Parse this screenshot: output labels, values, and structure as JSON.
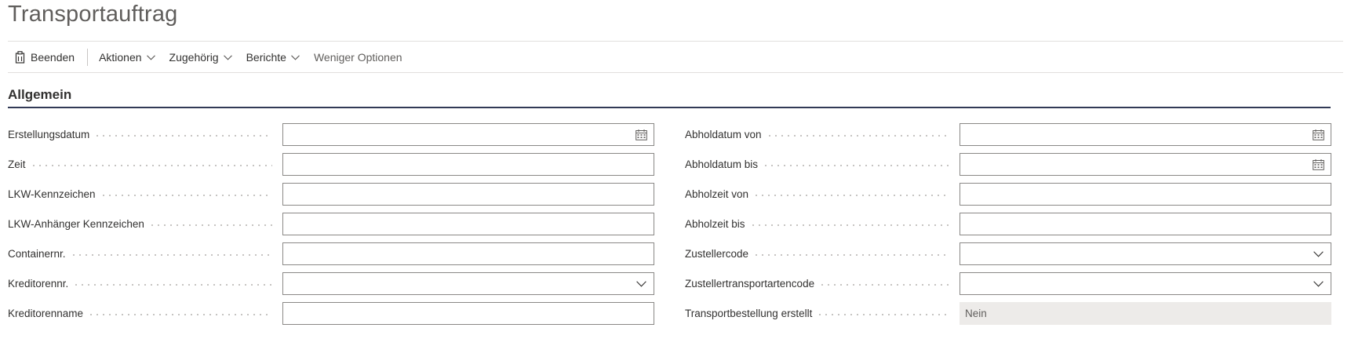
{
  "page": {
    "title": "Transportauftrag"
  },
  "actionbar": {
    "items": [
      {
        "label": "Beenden",
        "icon": "close-document-icon",
        "dropdown": false
      },
      {
        "label": "Aktionen",
        "dropdown": true
      },
      {
        "label": "Zugehörig",
        "dropdown": true
      },
      {
        "label": "Berichte",
        "dropdown": true
      },
      {
        "label": "Weniger Optionen",
        "dropdown": false
      }
    ]
  },
  "section": {
    "title": "Allgemein"
  },
  "fields": {
    "left": [
      {
        "label": "Erstellungsdatum",
        "value": "",
        "control": "date"
      },
      {
        "label": "Zeit",
        "value": "",
        "control": "text"
      },
      {
        "label": "LKW-Kennzeichen",
        "value": "",
        "control": "text"
      },
      {
        "label": "LKW-Anhänger Kennzeichen",
        "value": "",
        "control": "text"
      },
      {
        "label": "Containernr.",
        "value": "",
        "control": "text"
      },
      {
        "label": "Kreditorennr.",
        "value": "",
        "control": "dropdown"
      },
      {
        "label": "Kreditorenname",
        "value": "",
        "control": "text"
      }
    ],
    "right": [
      {
        "label": "Abholdatum von",
        "value": "",
        "control": "date"
      },
      {
        "label": "Abholdatum bis",
        "value": "",
        "control": "date"
      },
      {
        "label": "Abholzeit von",
        "value": "",
        "control": "text"
      },
      {
        "label": "Abholzeit bis",
        "value": "",
        "control": "text"
      },
      {
        "label": "Zustellercode",
        "value": "",
        "control": "dropdown"
      },
      {
        "label": "Zustellertransportartencode",
        "value": "",
        "control": "dropdown"
      },
      {
        "label": "Transportbestellung erstellt",
        "value": "Nein",
        "control": "readonly"
      }
    ]
  },
  "colors": {
    "accent": "#323a56",
    "field_border": "#8a8886",
    "readonly_bg": "#edebe9"
  }
}
